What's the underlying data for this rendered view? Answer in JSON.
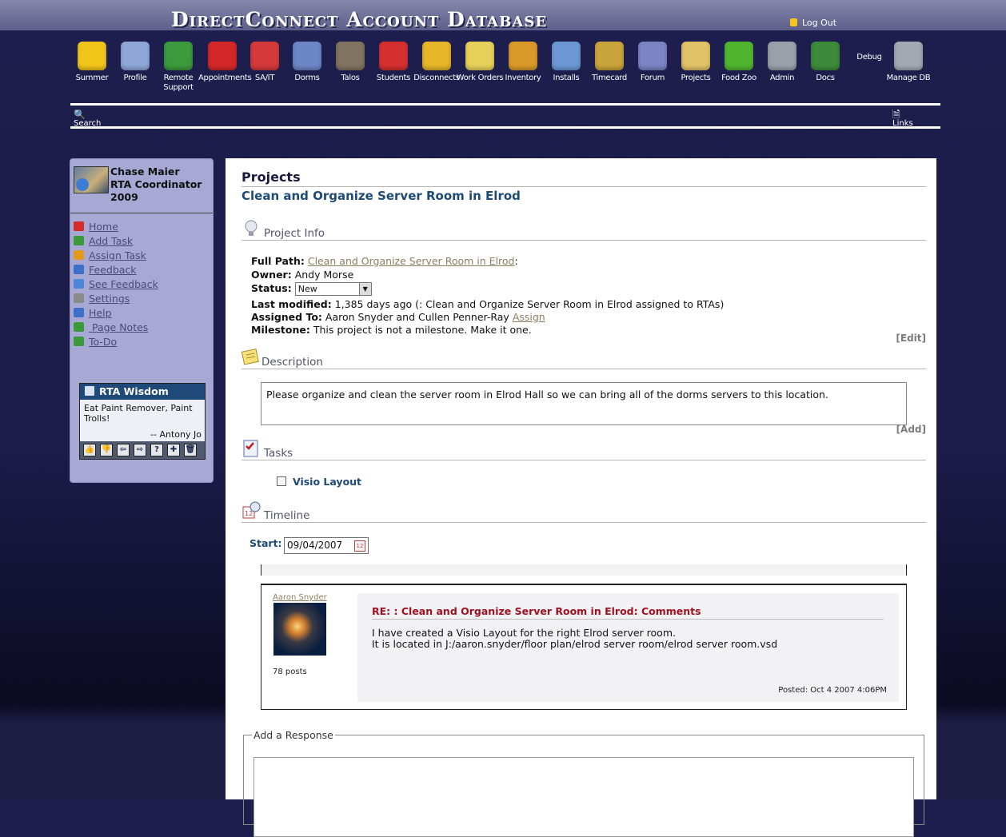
{
  "site": {
    "title": "DirectConnect Account Database",
    "logout_label": "Log Out"
  },
  "nav": [
    {
      "label": "Summer",
      "icon": "smiley-sunglasses-icon",
      "color": "#f2c51a"
    },
    {
      "label": "Profile",
      "icon": "profile-picture-icon",
      "color": "#8fa6d8"
    },
    {
      "label": "Remote\nSupport",
      "icon": "globe-help-icon",
      "color": "#3c9a3c"
    },
    {
      "label": "Appointments",
      "icon": "alarm-clock-icon",
      "color": "#d42828"
    },
    {
      "label": "SA/IT",
      "icon": "first-aid-icon",
      "color": "#d43a3a"
    },
    {
      "label": "Dorms",
      "icon": "building-icon",
      "color": "#6d86c6"
    },
    {
      "label": "Talos",
      "icon": "skull-icon",
      "color": "#807460"
    },
    {
      "label": "Students",
      "icon": "person-icon",
      "color": "#d43030"
    },
    {
      "label": "Disconnects",
      "icon": "unplug-icon",
      "color": "#e4b628"
    },
    {
      "label": "Work Orders",
      "icon": "pin-note-icon",
      "color": "#e7d05a"
    },
    {
      "label": "Inventory",
      "icon": "box-icon",
      "color": "#d99a29"
    },
    {
      "label": "Installs",
      "icon": "cd-install-icon",
      "color": "#6b98d4"
    },
    {
      "label": "Timecard",
      "icon": "money-bag-icon",
      "color": "#c9a43a"
    },
    {
      "label": "Forum",
      "icon": "speech-bubble-icon",
      "color": "#7b84c4"
    },
    {
      "label": "Projects",
      "icon": "folder-icon",
      "color": "#e0c267"
    },
    {
      "label": "Food Zoo",
      "icon": "apple-icon",
      "color": "#4fb52f"
    },
    {
      "label": "Admin",
      "icon": "gears-icon",
      "color": "#9aa0a8"
    },
    {
      "label": "Docs",
      "icon": "books-icon",
      "color": "#3d8a3a"
    },
    {
      "label": "Debug",
      "icon": "",
      "color": ""
    },
    {
      "label": "Manage DB",
      "icon": "database-check-icon",
      "color": "#a3a9b2"
    }
  ],
  "utility": {
    "search_label": "Search",
    "links_label": "Links"
  },
  "sidebar": {
    "user": {
      "name": "Chase Maier",
      "role": "RTA Coordinator",
      "year": "2009"
    },
    "menu": [
      {
        "label": "Home",
        "icon": "home-icon",
        "color": "#d42b2b"
      },
      {
        "label": "Add Task",
        "icon": "check-icon",
        "color": "#3a9a3a"
      },
      {
        "label": "Assign Task",
        "icon": "user-assign-icon",
        "color": "#e29a1e"
      },
      {
        "label": "Feedback",
        "icon": "info-icon",
        "color": "#3e6fc9"
      },
      {
        "label": "See Feedback",
        "icon": "magnifier-icon",
        "color": "#4f86d8"
      },
      {
        "label": "Settings",
        "icon": "tools-icon",
        "color": "#8a8a8a"
      },
      {
        "label": "Help",
        "icon": "help-icon",
        "color": "#3e6fc9"
      },
      {
        "label": " Page Notes",
        "icon": "note-icon",
        "color": "#3a9a3a"
      },
      {
        "label": "To-Do",
        "icon": "todo-icon",
        "color": "#3a9a3a"
      }
    ],
    "wisdom": {
      "title": "RTA Wisdom",
      "quote": "Eat Paint Remover, Paint Trolls!",
      "author": "-- Antony Jo",
      "tools": [
        "thumbs-up-icon",
        "thumbs-down-icon",
        "prev-icon",
        "next-icon",
        "question-icon",
        "add-icon",
        "delete-icon"
      ],
      "tool_glyphs": [
        "👍",
        "👎",
        "⇦",
        "⇨",
        "?",
        "✚",
        "🗑"
      ]
    }
  },
  "main": {
    "heading": "Projects",
    "project_title": "Clean and Organize Server Room in Elrod",
    "project_info": {
      "section_label": "Project Info",
      "full_path_label": "Full Path:",
      "full_path_value": "Clean and Organize Server Room in Elrod",
      "full_path_suffix": ":",
      "owner_label": "Owner:",
      "owner_value": "Andy Morse",
      "status_label": "Status:",
      "status_value": "New",
      "modified_label": "Last modified:",
      "modified_value": "1,385 days ago (: Clean and Organize Server Room in Elrod assigned to RTAs)",
      "assigned_label": "Assigned To:",
      "assigned_value": "Aaron Snyder and Cullen Penner-Ray",
      "assign_link": "Assign",
      "milestone_label": "Milestone:",
      "milestone_value": "This project is not a milestone. Make it one.",
      "edit_link": "[Edit]"
    },
    "description": {
      "section_label": "Description",
      "text": "Please organize and clean the server room in Elrod Hall so we can bring all of the dorms servers to this location.",
      "add_link": "[Add]"
    },
    "tasks": {
      "section_label": "Tasks",
      "items": [
        "Visio Layout"
      ]
    },
    "timeline": {
      "section_label": "Timeline",
      "start_label": "Start:",
      "start_value": "09/04/2007"
    },
    "comment": {
      "author": "Aaron Snyder",
      "posts": "78 posts",
      "title": "RE: : Clean and Organize Server Room in Elrod: Comments",
      "line1": "I have created a Visio Layout for the right Elrod server room.",
      "line2": "It is located in J:/aaron.snyder/floor plan/elrod server room/elrod server room.vsd",
      "date": "Posted: Oct 4 2007 4:06PM"
    },
    "response": {
      "legend": "Add a Response"
    }
  }
}
